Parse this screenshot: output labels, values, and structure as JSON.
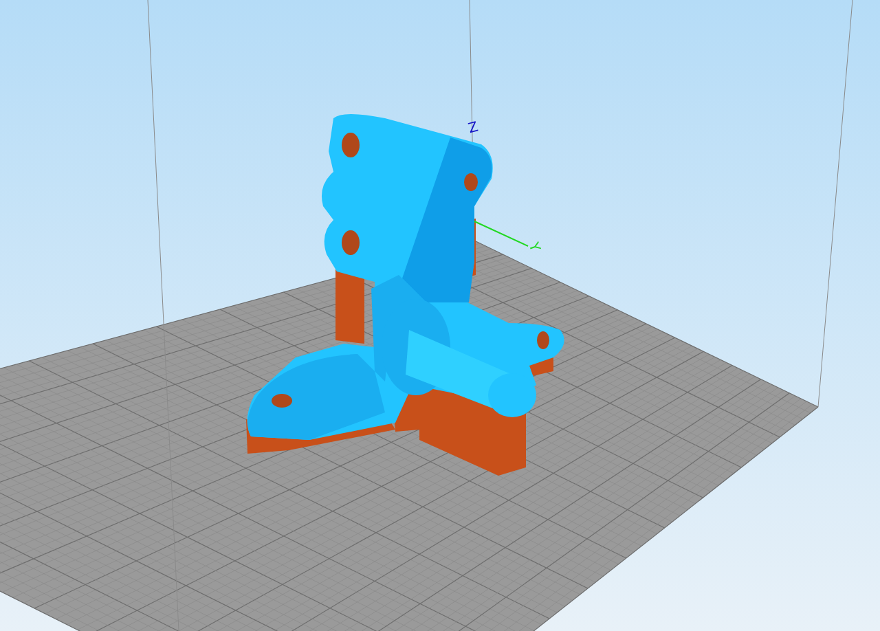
{
  "viewport": {
    "axes": [
      {
        "label": "Z",
        "color": "#1616c8"
      },
      {
        "label": "Y",
        "color": "#22d822"
      }
    ]
  }
}
